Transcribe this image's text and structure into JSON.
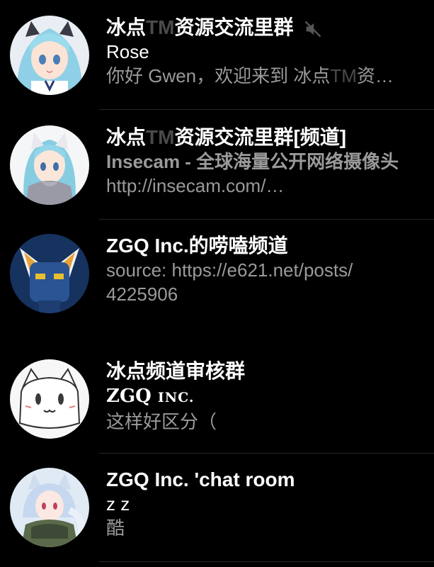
{
  "chats": [
    {
      "title_a": "冰点",
      "title_tm": "TM",
      "title_b": "资源交流里群",
      "muted": true,
      "line1": "Rose",
      "line2_a": "你好 Gwen，欢迎来到 冰点",
      "line2_tm": "TM",
      "line2_b": "资…"
    },
    {
      "title_a": "冰点",
      "title_tm": "TM",
      "title_b": "资源交流里群[频道]",
      "line1": "Insecam - 全球海量公开网络摄像头",
      "line2": "http://insecam.com/…"
    },
    {
      "title": "ZGQ Inc.的唠嗑频道",
      "line1": "source: https://e621.net/posts/",
      "line2": "4225906"
    },
    {
      "title": "冰点频道审核群",
      "line1_a": "ZGQ ",
      "line1_b": "INC.",
      "line2": "这样好区分（"
    },
    {
      "title": "ZGQ Inc. 'chat room",
      "line1": "z z",
      "line2": "酷"
    }
  ],
  "icons": {
    "mute": "speaker-muted-icon"
  },
  "colors": {
    "background": "#000000",
    "title": "#ffffff",
    "secondary": "#9a9a9a",
    "tm": "#4a4a4a",
    "divider": "#262626"
  }
}
